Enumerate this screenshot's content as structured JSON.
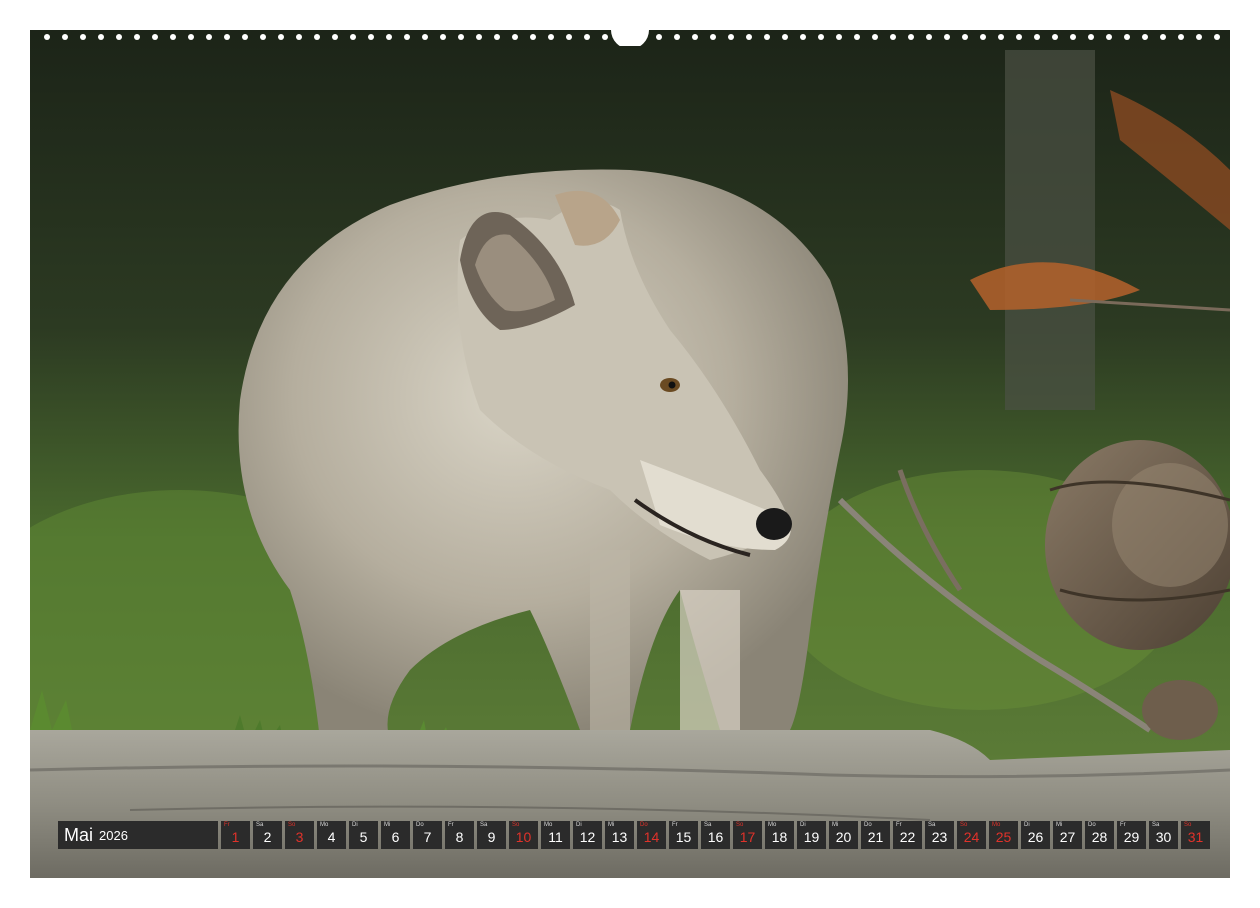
{
  "calendar": {
    "month": "Mai",
    "year": "2026",
    "days": [
      {
        "abbr": "Fr",
        "num": "1",
        "holiday": true
      },
      {
        "abbr": "Sa",
        "num": "2",
        "holiday": false
      },
      {
        "abbr": "So",
        "num": "3",
        "holiday": true
      },
      {
        "abbr": "Mo",
        "num": "4",
        "holiday": false
      },
      {
        "abbr": "Di",
        "num": "5",
        "holiday": false
      },
      {
        "abbr": "Mi",
        "num": "6",
        "holiday": false
      },
      {
        "abbr": "Do",
        "num": "7",
        "holiday": false
      },
      {
        "abbr": "Fr",
        "num": "8",
        "holiday": false
      },
      {
        "abbr": "Sa",
        "num": "9",
        "holiday": false
      },
      {
        "abbr": "So",
        "num": "10",
        "holiday": true
      },
      {
        "abbr": "Mo",
        "num": "11",
        "holiday": false
      },
      {
        "abbr": "Di",
        "num": "12",
        "holiday": false
      },
      {
        "abbr": "Mi",
        "num": "13",
        "holiday": false
      },
      {
        "abbr": "Do",
        "num": "14",
        "holiday": true
      },
      {
        "abbr": "Fr",
        "num": "15",
        "holiday": false
      },
      {
        "abbr": "Sa",
        "num": "16",
        "holiday": false
      },
      {
        "abbr": "So",
        "num": "17",
        "holiday": true
      },
      {
        "abbr": "Mo",
        "num": "18",
        "holiday": false
      },
      {
        "abbr": "Di",
        "num": "19",
        "holiday": false
      },
      {
        "abbr": "Mi",
        "num": "20",
        "holiday": false
      },
      {
        "abbr": "Do",
        "num": "21",
        "holiday": false
      },
      {
        "abbr": "Fr",
        "num": "22",
        "holiday": false
      },
      {
        "abbr": "Sa",
        "num": "23",
        "holiday": false
      },
      {
        "abbr": "So",
        "num": "24",
        "holiday": true
      },
      {
        "abbr": "Mo",
        "num": "25",
        "holiday": true
      },
      {
        "abbr": "Di",
        "num": "26",
        "holiday": false
      },
      {
        "abbr": "Mi",
        "num": "27",
        "holiday": false
      },
      {
        "abbr": "Do",
        "num": "28",
        "holiday": false
      },
      {
        "abbr": "Fr",
        "num": "29",
        "holiday": false
      },
      {
        "abbr": "Sa",
        "num": "30",
        "holiday": false
      },
      {
        "abbr": "So",
        "num": "31",
        "holiday": true
      }
    ]
  },
  "colors": {
    "cell_background": "#2b2b2b",
    "holiday_red": "#e0322a",
    "text_white": "#ffffff"
  }
}
